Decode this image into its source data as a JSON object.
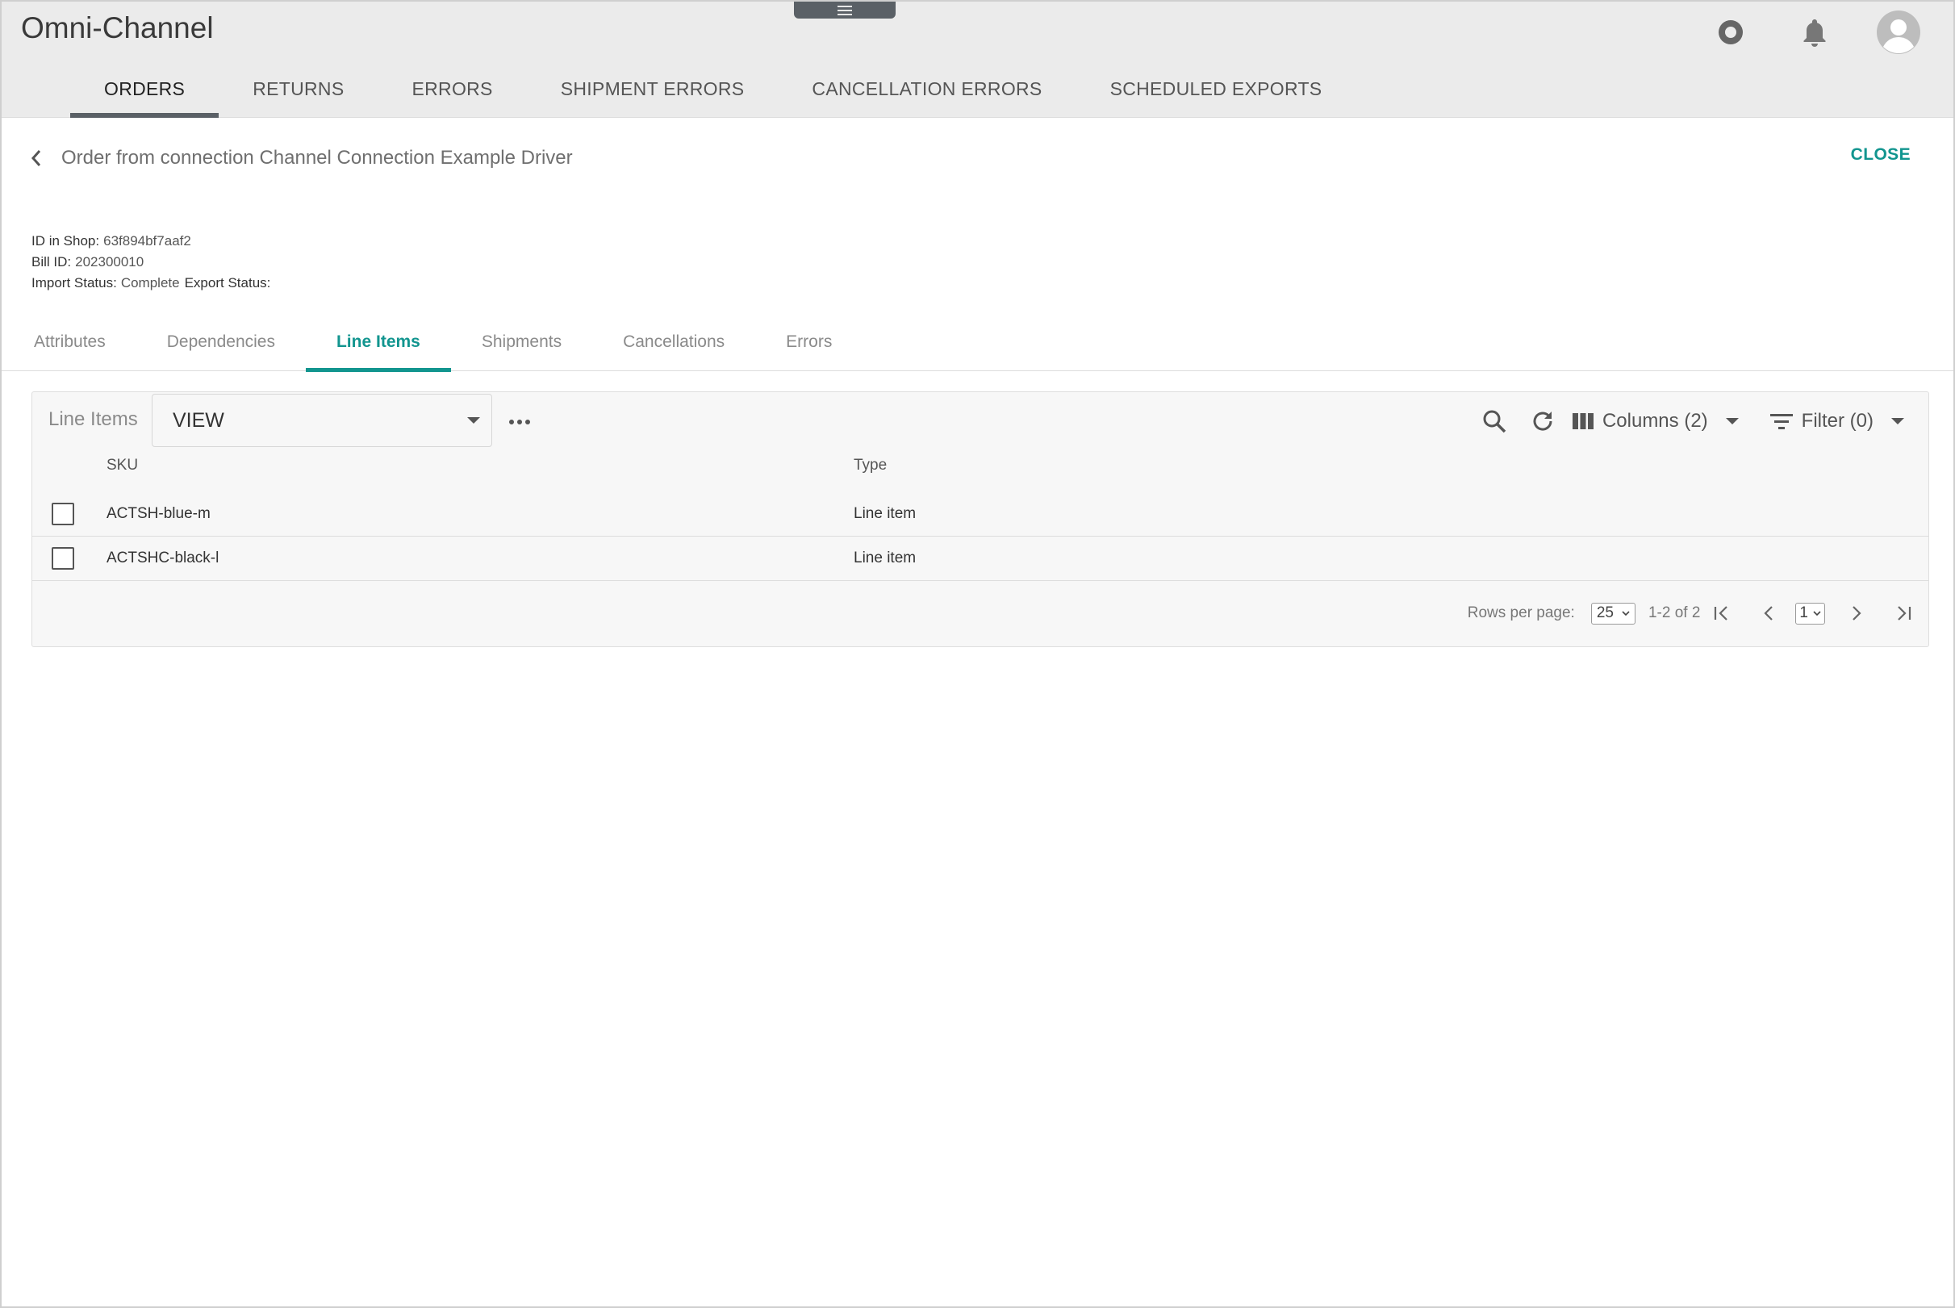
{
  "app": {
    "title": "Omni-Channel"
  },
  "header_icons": [
    "record-icon",
    "bell-icon",
    "avatar-icon"
  ],
  "main_tabs": [
    {
      "label": "ORDERS",
      "active": true
    },
    {
      "label": "RETURNS",
      "active": false
    },
    {
      "label": "ERRORS",
      "active": false
    },
    {
      "label": "SHIPMENT ERRORS",
      "active": false
    },
    {
      "label": "CANCELLATION ERRORS",
      "active": false
    },
    {
      "label": "SCHEDULED EXPORTS",
      "active": false
    }
  ],
  "detail": {
    "title": "Order from connection Channel Connection Example Driver",
    "close_label": "CLOSE",
    "meta": {
      "id_in_shop_label": "ID in Shop:",
      "id_in_shop_value": "63f894bf7aaf2",
      "bill_id_label": "Bill ID:",
      "bill_id_value": "202300010",
      "import_status_label": "Import Status:",
      "import_status_value": "Complete",
      "export_status_label": "Export Status:",
      "export_status_value": ""
    }
  },
  "sub_tabs": [
    {
      "label": "Attributes",
      "active": false
    },
    {
      "label": "Dependencies",
      "active": false
    },
    {
      "label": "Line Items",
      "active": true
    },
    {
      "label": "Shipments",
      "active": false
    },
    {
      "label": "Cancellations",
      "active": false
    },
    {
      "label": "Errors",
      "active": false
    }
  ],
  "grid": {
    "title": "Line Items",
    "view_select": "VIEW",
    "columns_label": "Columns (2)",
    "filter_label": "Filter (0)",
    "headers": {
      "sku": "SKU",
      "type": "Type"
    },
    "rows": [
      {
        "sku": "ACTSH-blue-m",
        "type": "Line item"
      },
      {
        "sku": "ACTSHC-black-l",
        "type": "Line item"
      }
    ],
    "pager": {
      "rows_per_page_label": "Rows per page:",
      "rows_per_page": "25",
      "range": "1-2 of 2",
      "page": "1"
    }
  },
  "colors": {
    "accent": "#12958f",
    "header_bg": "#ebebeb",
    "tab_indicator": "#5a6066"
  }
}
